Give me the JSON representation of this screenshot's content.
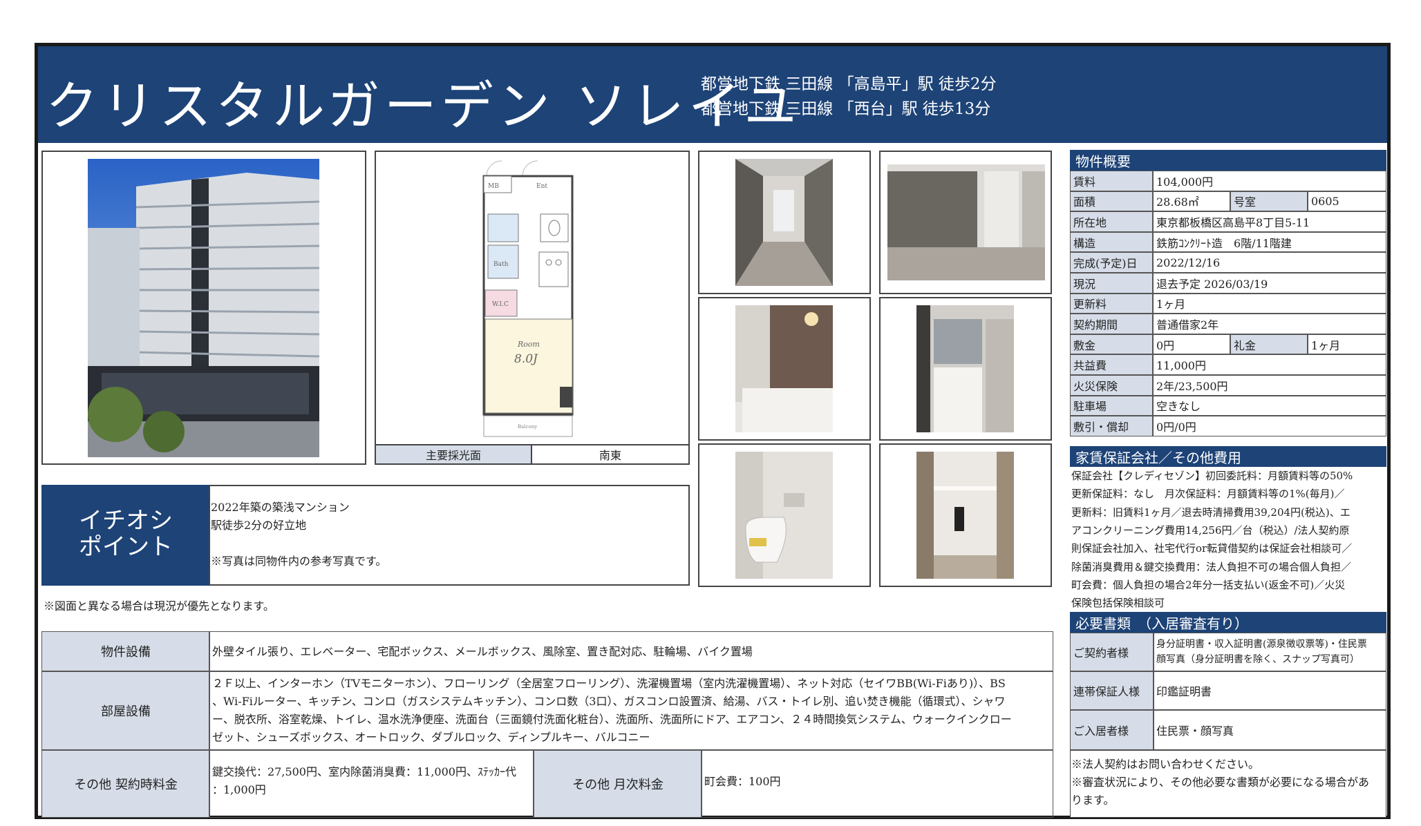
{
  "header": {
    "title": "クリスタルガーデン ソレイユ",
    "station1": "都営地下鉄 三田線 「高島平」駅 徒歩2分",
    "station2": "都営地下鉄 三田線 「西台」駅 徒歩13分"
  },
  "floorplan": {
    "room_label": "Room",
    "room_size": "8.0J",
    "balcony_label": "Balcony",
    "wic_label": "W.I.C",
    "bath_label": "Bath",
    "mb_label": "MB",
    "ent_label": "Ent",
    "lighting_label": "主要採光面",
    "lighting_value": "南東"
  },
  "recommend": {
    "heading_line1": "イチオシ",
    "heading_line2": "ポイント",
    "line1": "2022年築の築浅マンション",
    "line2": "駅徒歩2分の好立地",
    "line3": "※写真は同物件内の参考写真です。"
  },
  "notice": "※図面と異なる場合は現況が優先となります。",
  "equipment": {
    "building_label": "物件設備",
    "building_value": "外壁タイル張り、エレベーター、宅配ボックス、メールボックス、風除室、置き配対応、駐輪場、バイク置場",
    "room_label": "部屋設備",
    "room_line1": "２Ｆ以上、インターホン（TVモニターホン）、フローリング（全居室フローリング）、洗濯機置場（室内洗濯機置場）、ネット対応（セイワBB(Wi-Fiあり)）、BS",
    "room_line2": "、Wi-Fiルーター、キッチン、コンロ（ガスシステムキッチン）、コンロ数（3口）、ガスコンロ設置済、給湯、バス・トイレ別、追い焚き機能（循環式）、シャワ",
    "room_line3": "ー、脱衣所、浴室乾燥、トイレ、温水洗浄便座、洗面台（三面鏡付洗面化粧台）、洗面所、洗面所にドア、エアコン、２４時間換気システム、ウォークインクロー",
    "room_line4": "ゼット、シューズボックス、オートロック、ダブルロック、ディンプルキー、バルコニー",
    "contract_label": "その他 契約時料金",
    "contract_line1": "鍵交換代：27,500円、室内除菌消臭費：11,000円、ｽﾃｯｶｰ代",
    "contract_line2": "：1,000円",
    "monthly_label": "その他 月次料金",
    "monthly_value": "町会費：100円"
  },
  "overview": {
    "heading": "物件概要",
    "rows": [
      {
        "label": "賃料",
        "value": "104,000円"
      },
      {
        "label": "面積",
        "value": "28.68㎡",
        "label2": "号室",
        "value2": "0605"
      },
      {
        "label": "所在地",
        "value": "東京都板橋区高島平8丁目5-11"
      },
      {
        "label": "構造",
        "value": "鉄筋ｺﾝｸﾘｰﾄ造　6階/11階建"
      },
      {
        "label": "完成(予定)日",
        "value": "2022/12/16"
      },
      {
        "label": "現況",
        "value": "退去予定 2026/03/19"
      },
      {
        "label": "更新料",
        "value": "1ヶ月"
      },
      {
        "label": "契約期間",
        "value": "普通借家2年"
      },
      {
        "label": "敷金",
        "value": "0円",
        "label2": "礼金",
        "value2": "1ヶ月"
      },
      {
        "label": "共益費",
        "value": "11,000円"
      },
      {
        "label": "火災保険",
        "value": "2年/23,500円"
      },
      {
        "label": "駐車場",
        "value": "空きなし"
      },
      {
        "label": "敷引・償却",
        "value": "0円/0円"
      }
    ]
  },
  "guarantee": {
    "heading": "家賃保証会社／その他費用",
    "lines": [
      "保証会社【クレディセゾン】初回委託料：月額賃料等の50%",
      "更新保証料：なし　月次保証料：月額賃料等の1%(毎月)／",
      "更新料：旧賃料1ヶ月／退去時清掃費用39,204円(税込)、エ",
      "アコンクリーニング費用14,256円／台（税込）/法人契約原",
      "則保証会社加入、社宅代行or転貸借契約は保証会社相談可／",
      "除菌消臭費用＆鍵交換費用：法人負担不可の場合個人負担／",
      "町会費：個人負担の場合2年分一括支払い(返金不可)／火災",
      "保険包括保険相談可"
    ]
  },
  "documents": {
    "heading": "必要書類　（入居審査有り）",
    "contractor_label": "ご契約者様",
    "contractor_line1": "身分証明書・収入証明書(源泉徴収票等)・住民票",
    "contractor_line2": "顔写真（身分証明書を除く、スナップ写真可）",
    "guarantor_label": "連帯保証人様",
    "guarantor_value": "印鑑証明書",
    "resident_label": "ご入居者様",
    "resident_value": "住民票・顔写真",
    "note1": "※法人契約はお問い合わせください。",
    "note2": "※審査状況により、その他必要な書類が必要になる場合があ",
    "note3": "ります。"
  }
}
